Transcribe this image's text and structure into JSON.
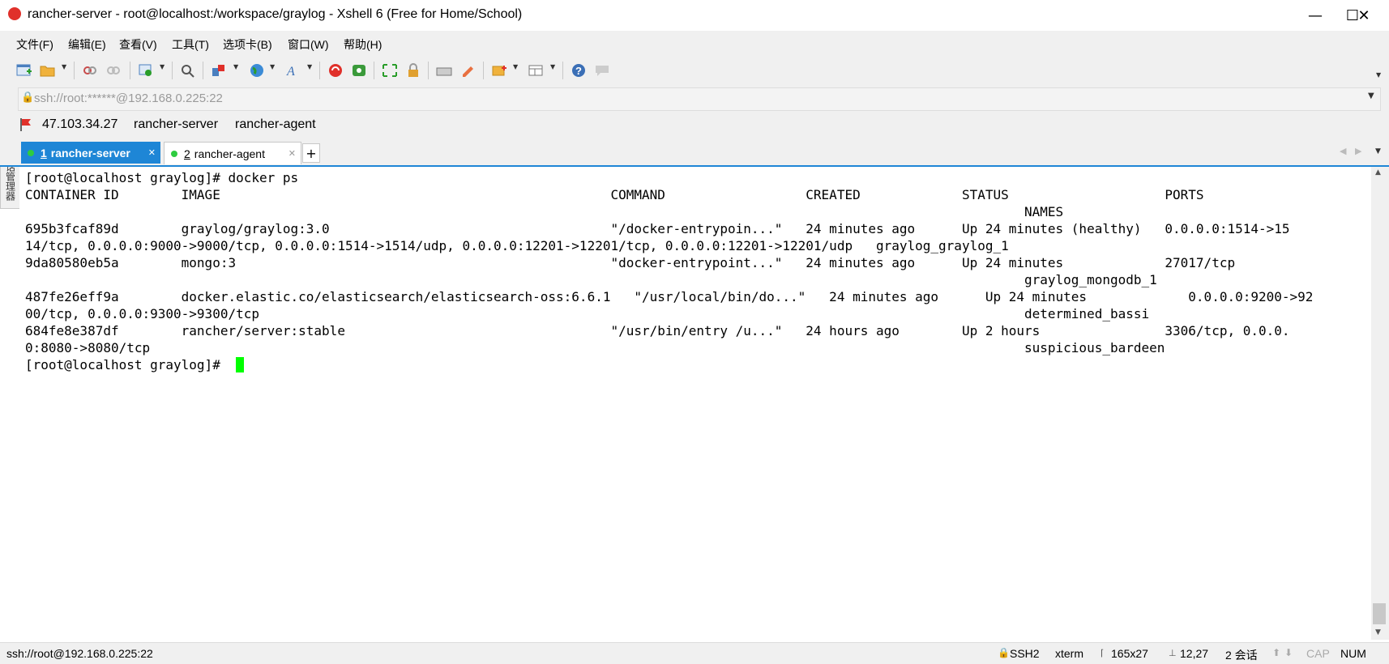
{
  "window": {
    "title": "rancher-server - root@localhost:/workspace/graylog - Xshell 6 (Free for Home/School)",
    "minimize_label": "—",
    "maximize_label": "☐",
    "close_label": "✕"
  },
  "menu": {
    "items": [
      "文件(F)",
      "编辑(E)",
      "查看(V)",
      "工具(T)",
      "选项卡(B)",
      "窗口(W)",
      "帮助(H)"
    ]
  },
  "address": {
    "value": "ssh://root:******@192.168.0.225:22"
  },
  "sessions_bar": {
    "items": [
      "47.103.34.27",
      "rancher-server",
      "rancher-agent"
    ]
  },
  "side_panel": {
    "label": "会话管理器"
  },
  "tabs": [
    {
      "num": "1",
      "label": "rancher-server",
      "close": "✕"
    },
    {
      "num": "2",
      "label": "rancher-agent",
      "close": "✕"
    }
  ],
  "add_tab_label": "+",
  "terminal": {
    "lines": [
      "[root@localhost graylog]# docker ps",
      "CONTAINER ID        IMAGE                                                  COMMAND                  CREATED             STATUS                    PORTS",
      "                                                                                                                                NAMES",
      "695b3fcaf89d        graylog/graylog:3.0                                    \"/docker-entrypoin...\"   24 minutes ago      Up 24 minutes (healthy)   0.0.0.0:1514->15",
      "14/tcp, 0.0.0.0:9000->9000/tcp, 0.0.0.0:1514->1514/udp, 0.0.0.0:12201->12201/tcp, 0.0.0.0:12201->12201/udp   graylog_graylog_1",
      "9da80580eb5a        mongo:3                                                \"docker-entrypoint...\"   24 minutes ago      Up 24 minutes             27017/tcp",
      "                                                                                                                                graylog_mongodb_1",
      "487fe26eff9a        docker.elastic.co/elasticsearch/elasticsearch-oss:6.6.1   \"/usr/local/bin/do...\"   24 minutes ago      Up 24 minutes             0.0.0.0:9200->92",
      "00/tcp, 0.0.0.0:9300->9300/tcp                                                                                                  determined_bassi",
      "684fe8e387df        rancher/server:stable                                  \"/usr/bin/entry /u...\"   24 hours ago        Up 2 hours                3306/tcp, 0.0.0.",
      "0:8080->8080/tcp                                                                                                                suspicious_bardeen",
      "[root@localhost graylog]# "
    ],
    "cursor_color": "#00ff00"
  },
  "status": {
    "connection": "ssh://root@192.168.0.225:22",
    "protocol": "SSH2",
    "term": "xterm",
    "size": "165x27",
    "position": "12,27",
    "sessions": "2 会话",
    "cap": "CAP",
    "num": "NUM"
  },
  "colors": {
    "accent": "#1e86d6",
    "active_tab_bg": "#1e86d6",
    "green_dot": "#2ecc40"
  },
  "toolbar_icons": [
    "new-session-icon",
    "open-folder-icon",
    "reconnect-icon",
    "disconnect-icon",
    "properties-icon",
    "find-icon",
    "transfer-icon",
    "globe-icon",
    "font-icon",
    "xshell-logo-icon",
    "xftp-icon",
    "fullscreen-icon",
    "lock-icon",
    "keyboard-icon",
    "highlight-icon",
    "compose-icon",
    "layout-icon",
    "help-icon",
    "chat-icon"
  ]
}
